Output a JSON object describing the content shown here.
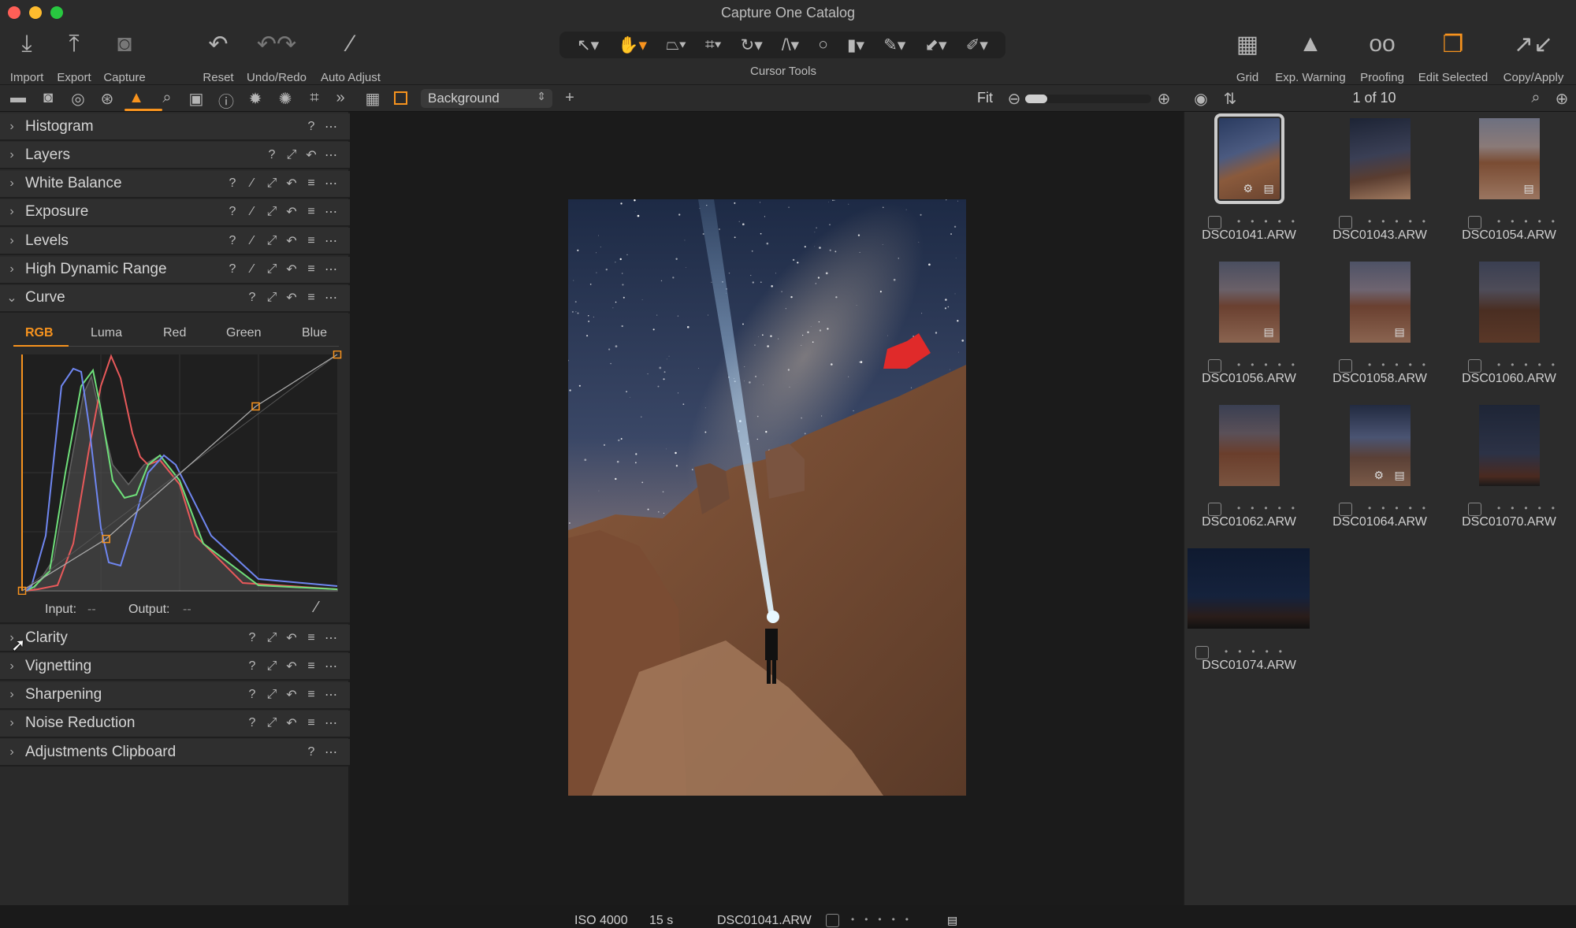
{
  "window": {
    "title": "Capture One Catalog",
    "traffic_lights": [
      "#fe5f57",
      "#febc2e",
      "#28c840"
    ]
  },
  "accent": "#f7931e",
  "toolbar": {
    "left": [
      {
        "label": "Import",
        "icon": "import-icon"
      },
      {
        "label": "Export",
        "icon": "export-icon"
      },
      {
        "label": "Capture",
        "icon": "camera-icon"
      },
      {
        "label": "Reset",
        "icon": "reset-icon"
      },
      {
        "label": "Undo/Redo",
        "icon": "undo-redo-icon"
      },
      {
        "label": "Auto Adjust",
        "icon": "magic-wand-icon"
      }
    ],
    "cursor_tools_label": "Cursor Tools",
    "cursor_tools": [
      "select-arrow-icon",
      "hand-pan-icon",
      "keystone-icon",
      "crop-icon",
      "rotate-icon",
      "straighten-icon",
      "circle-brush-icon",
      "gradient-mask-icon",
      "color-picker-icon",
      "apply-icon",
      "annotation-pen-icon"
    ],
    "right": [
      {
        "label": "Grid",
        "icon": "grid-icon"
      },
      {
        "label": "Exp. Warning",
        "icon": "warning-icon"
      },
      {
        "label": "Proofing",
        "icon": "glasses-icon"
      },
      {
        "label": "Edit Selected",
        "icon": "edit-selected-icon"
      },
      {
        "label": "Copy/Apply",
        "icon": "copy-apply-icon"
      }
    ]
  },
  "tool_tabs": [
    "folder-icon",
    "camera-icon",
    "lens-icon",
    "color-icon",
    "exposure-icon",
    "details-icon",
    "metadata-icon",
    "info-icon",
    "adjustments-gear-icon",
    "batch-gears-icon",
    "crop-icon",
    "more-chevrons-icon"
  ],
  "viewer_toolbar": {
    "layer_select": "Background",
    "zoom_label": "Fit",
    "zoom_level": 0.08
  },
  "browser_toolbar": {
    "count": "1 of 10"
  },
  "panels_top": [
    {
      "title": "Histogram",
      "icons": [
        "help",
        "more"
      ]
    },
    {
      "title": "Layers",
      "icons": [
        "help",
        "popout",
        "reset",
        "more"
      ]
    },
    {
      "title": "White Balance",
      "icons": [
        "help",
        "picker",
        "popout",
        "reset",
        "presets",
        "more"
      ]
    },
    {
      "title": "Exposure",
      "icons": [
        "help",
        "picker",
        "popout",
        "reset",
        "presets",
        "more"
      ]
    },
    {
      "title": "Levels",
      "icons": [
        "help",
        "picker",
        "popout",
        "reset",
        "presets",
        "more"
      ]
    },
    {
      "title": "High Dynamic Range",
      "icons": [
        "help",
        "picker",
        "popout",
        "reset",
        "presets",
        "more"
      ]
    },
    {
      "title": "Curve",
      "icons": [
        "help",
        "popout",
        "reset",
        "presets",
        "more"
      ],
      "expanded": true
    }
  ],
  "curve": {
    "tabs": [
      "RGB",
      "Luma",
      "Red",
      "Green",
      "Blue"
    ],
    "active_tab": "RGB",
    "input_label": "Input:",
    "input_value": "--",
    "output_label": "Output:",
    "output_value": "--",
    "points": [
      [
        0,
        0
      ],
      [
        68,
        56
      ],
      [
        189,
        199
      ],
      [
        255,
        255
      ]
    ],
    "colors": {
      "red": "#e8595a",
      "green": "#6fe07a",
      "blue": "#6f86f0",
      "luma": "#9a9a9a"
    }
  },
  "panels_bottom": [
    {
      "title": "Clarity",
      "icons": [
        "help",
        "popout",
        "reset",
        "presets",
        "more"
      ]
    },
    {
      "title": "Vignetting",
      "icons": [
        "help",
        "popout",
        "reset",
        "presets",
        "more"
      ]
    },
    {
      "title": "Sharpening",
      "icons": [
        "help",
        "popout",
        "reset",
        "presets",
        "more"
      ]
    },
    {
      "title": "Noise Reduction",
      "icons": [
        "help",
        "popout",
        "reset",
        "presets",
        "more"
      ]
    },
    {
      "title": "Adjustments Clipboard",
      "icons": [
        "help",
        "more"
      ]
    }
  ],
  "viewer": {
    "iso": "ISO 4000",
    "shutter": "15 s",
    "filename": "DSC01041.ARW",
    "rating": 0
  },
  "thumbnails": [
    {
      "name": "DSC01041.ARW",
      "selected": true,
      "badges": [
        "gear",
        "sidecar"
      ]
    },
    {
      "name": "DSC01043.ARW",
      "badges": []
    },
    {
      "name": "DSC01054.ARW",
      "badges": [
        "sidecar"
      ]
    },
    {
      "name": "DSC01056.ARW",
      "badges": [
        "sidecar"
      ]
    },
    {
      "name": "DSC01058.ARW",
      "badges": [
        "sidecar"
      ]
    },
    {
      "name": "DSC01060.ARW",
      "badges": []
    },
    {
      "name": "DSC01062.ARW",
      "badges": []
    },
    {
      "name": "DSC01064.ARW",
      "badges": [
        "gear",
        "sidecar"
      ]
    },
    {
      "name": "DSC01070.ARW",
      "badges": []
    },
    {
      "name": "DSC01074.ARW",
      "badges": [],
      "landscape": true
    }
  ]
}
